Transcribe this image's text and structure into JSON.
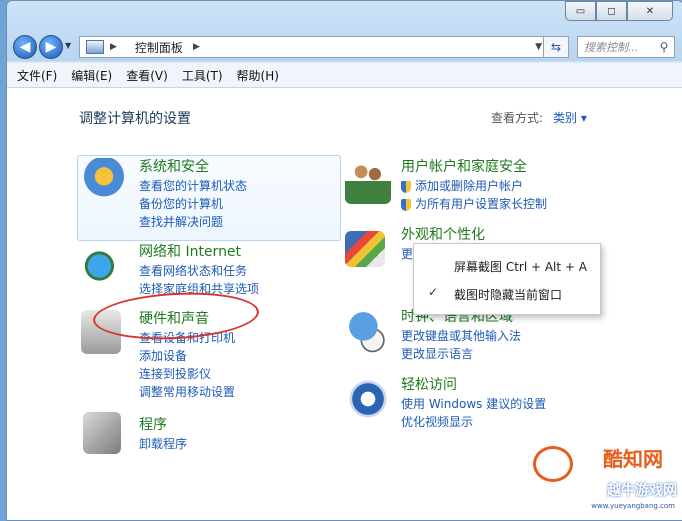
{
  "window": {
    "caption_buttons": {
      "minimize": "▭",
      "maximize": "◻",
      "close": "✕"
    }
  },
  "nav": {
    "back_icon": "back-arrow",
    "forward_icon": "forward-arrow",
    "address_crumb": "控制面板",
    "search_placeholder": "搜索控制..."
  },
  "menu": [
    "文件(F)",
    "编辑(E)",
    "查看(V)",
    "工具(T)",
    "帮助(H)"
  ],
  "main": {
    "heading": "调整计算机的设置",
    "view_by_label": "查看方式:",
    "view_by_value": "类别 ▾"
  },
  "categories": {
    "system": {
      "title": "系统和安全",
      "links": [
        "查看您的计算机状态",
        "备份您的计算机",
        "查找并解决问题"
      ]
    },
    "network": {
      "title": "网络和 Internet",
      "links": [
        "查看网络状态和任务",
        "选择家庭组和共享选项"
      ]
    },
    "hardware": {
      "title": "硬件和声音",
      "links": [
        "查看设备和打印机",
        "添加设备",
        "连接到投影仪",
        "调整常用移动设置"
      ]
    },
    "programs": {
      "title": "程序",
      "links": [
        "卸载程序"
      ]
    },
    "users": {
      "title": "用户帐户和家庭安全",
      "links": [
        "添加或删除用户帐户",
        "为所有用户设置家长控制"
      ]
    },
    "appearance": {
      "title": "外观和个性化",
      "links": [
        "更"
      ]
    },
    "clock": {
      "title": "时钟、语言和区域",
      "links": [
        "更改键盘或其他输入法",
        "更改显示语言"
      ]
    },
    "ease": {
      "title": "轻松访问",
      "links": [
        "使用 Windows 建议的设置",
        "优化视频显示"
      ]
    }
  },
  "context_menu": {
    "item1": "屏幕截图 Ctrl + Alt + A",
    "item2": "截图时隐藏当前窗口",
    "check": "✓"
  },
  "watermark": {
    "brand": "酷知网",
    "site": "越牛游戏网",
    "url": "www.yueyangbang.com"
  }
}
